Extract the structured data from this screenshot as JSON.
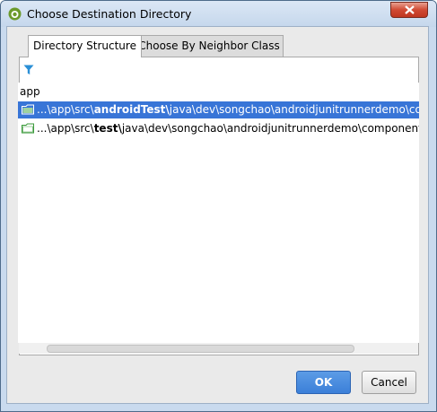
{
  "window": {
    "title": "Choose Destination Directory",
    "app_icon": "android-icon",
    "close_icon": "close-icon"
  },
  "tabs": [
    {
      "label": "Directory Structure",
      "active": true
    },
    {
      "label": "Choose By Neighbor Class",
      "active": false
    }
  ],
  "toolbar": {
    "filter_icon": "filter-icon"
  },
  "tree": {
    "root_label": "app",
    "rows": [
      {
        "icon": "folder-icon",
        "prefix": "...\\app\\src\\",
        "bold": "androidTest\\",
        "suffix": "java\\dev\\songchao\\androidjunitrunnerdemo\\component\\",
        "selected": true
      },
      {
        "icon": "folder-icon",
        "prefix": "...\\app\\src\\",
        "bold": "test\\",
        "suffix": "java\\dev\\songchao\\androidjunitrunnerdemo\\component\\",
        "selected": false
      }
    ]
  },
  "buttons": {
    "ok_label": "OK",
    "cancel_label": "Cancel"
  },
  "colors": {
    "selection": "#3875d7",
    "ok_button": "#3b7fd8",
    "folder_green": "#3a9a3a",
    "filter_blue": "#2a8fd6",
    "title_bar": "#c5d7ec"
  }
}
